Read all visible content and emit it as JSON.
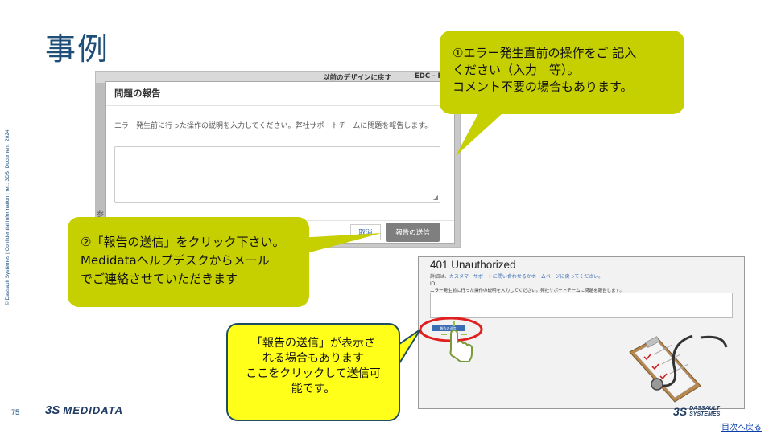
{
  "slide": {
    "title": "事例",
    "side_text": "© Dassault Systèmes | Confidential Information | ref.: 3DS_Document_2024",
    "page_number": "75",
    "logo_mark": "3S",
    "logo_text": "MEDIDATA",
    "ds_logo_mark": "3S",
    "ds_logo_line1": "DASSAULT",
    "ds_logo_line2": "SYSTEMES",
    "toc_link": "目次へ戻る"
  },
  "screenshot1": {
    "topbar_left": "以前のデザインに戻す",
    "topbar_right": "EDC - F",
    "strip_glyph": "参",
    "dialog": {
      "title": "問題の報告",
      "description": "エラー発生前に行った操作の説明を入力してください。弊社サポートチームに問題を報告します。",
      "textarea_value": "",
      "cancel_label": "取消",
      "send_label": "報告の送信"
    }
  },
  "screenshot2": {
    "title": "401 Unauthorized",
    "sub_prefix": "詳細は、",
    "sub_link": "カスタマーサポートに問い合わせるかホームページに戻ってください。",
    "id_label": "ID",
    "instruction": "エラー発生前に行った操作の説明を入力してください。弊社サポートチームに問題を報告します。",
    "send_label": "報告の送信"
  },
  "callouts": {
    "c1": [
      "①エラー発生直前の操作をご 記入",
      "ください（入力　等）。",
      "コメント不要の場合もあります。"
    ],
    "c2": [
      "②「報告の送信」をクリック下さい。",
      "Medidataヘルプデスクからメール",
      "でご連絡させていただきます"
    ],
    "c3": [
      "「報告の送信」が表示さ",
      "れる場合もあります",
      "ここをクリックして送信可",
      "能です。"
    ]
  },
  "colors": {
    "title_blue": "#1f4e79",
    "callout_green": "#c6cf00",
    "callout_yellow": "#ffff1a",
    "highlight_red": "#e02020",
    "send_gray": "#7f7f7f"
  },
  "icons": {
    "pointer": "hand-pointer-icon",
    "clipboard": "clipboard-stethoscope-icon"
  }
}
